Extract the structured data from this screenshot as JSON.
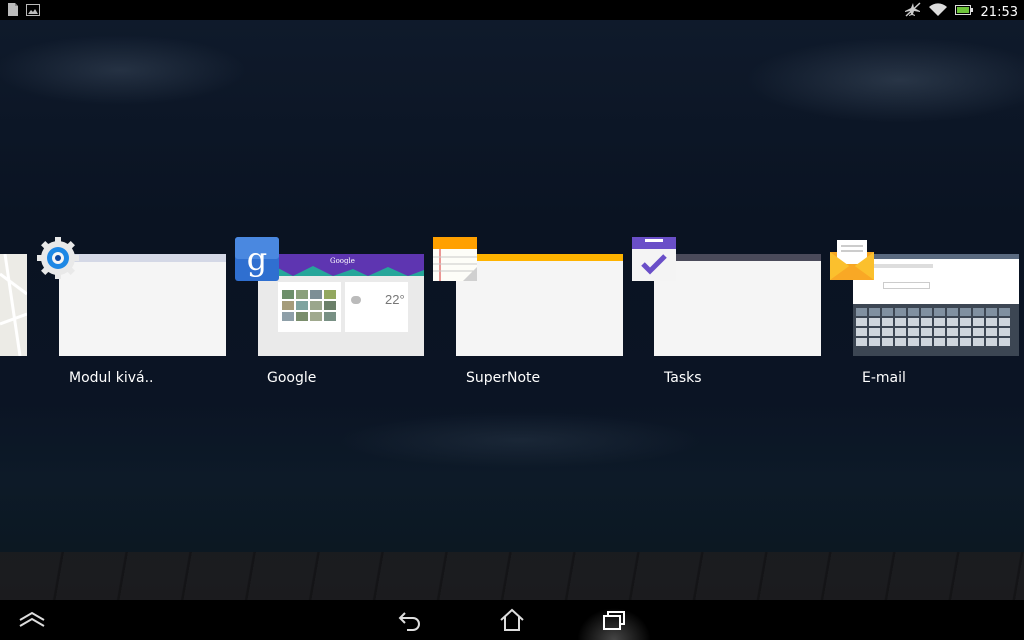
{
  "status_bar": {
    "time": "21:53",
    "left_icons": [
      "document-icon",
      "image-icon"
    ],
    "right_icons": [
      "airplane-off-icon",
      "wifi-icon",
      "battery-icon"
    ],
    "battery_color": "#6ec43a"
  },
  "recent_apps": [
    {
      "label": "Modul kivá..",
      "icon": "settings-gear-icon"
    },
    {
      "label": "Google",
      "icon": "google-search-icon",
      "weather_temp": "22°",
      "header": "Google"
    },
    {
      "label": "SuperNote",
      "icon": "supernote-notepad-icon",
      "accent": "#ffb300"
    },
    {
      "label": "Tasks",
      "icon": "tasks-checkbox-icon",
      "accent": "#6a4fc8"
    },
    {
      "label": "E-mail",
      "icon": "email-envelope-icon",
      "accent": "#f5a623"
    }
  ],
  "nav_bar": {
    "buttons": [
      "hide-nav-icon",
      "back-icon",
      "home-icon",
      "recent-apps-icon"
    ],
    "active": "recent-apps-icon"
  }
}
